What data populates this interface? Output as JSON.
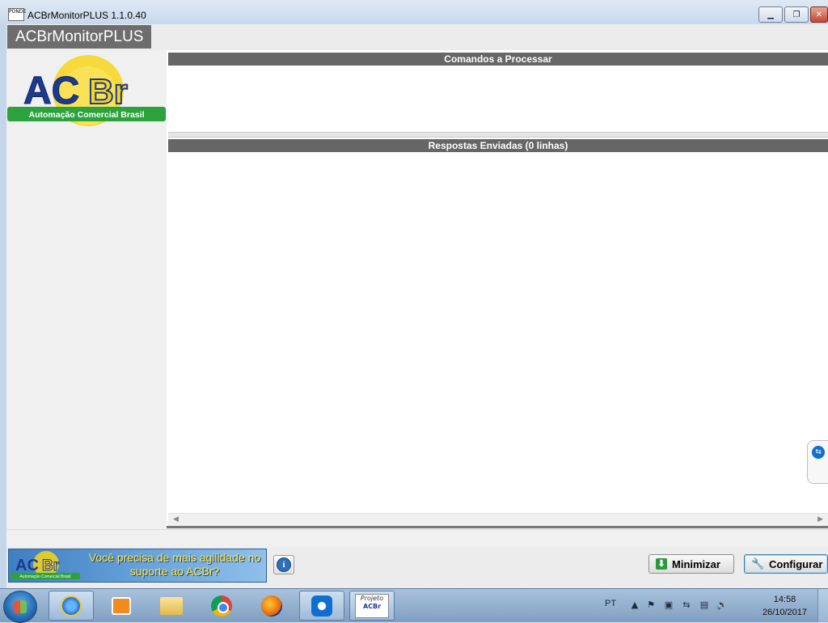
{
  "window": {
    "title": "ACBrMonitorPLUS 1.1.0.40",
    "icon_text": "PONDE",
    "controls": [
      "minimize-icon",
      "restore-icon",
      "close-icon"
    ]
  },
  "app": {
    "title": "ACBrMonitorPLUS"
  },
  "logo": {
    "main_text": "ACBr",
    "tagline": "Automação Comercial Brasil",
    "colors": {
      "blue": "#1d3a8f",
      "yellow": "#f7d51a",
      "green": "#2ba23b"
    }
  },
  "panels": {
    "top_header": "Comandos a Processar",
    "bottom_header": "Respostas Enviadas (0 linhas)"
  },
  "footer": {
    "banner_text": "Você precisa de mais agilidade no suporte ao ACBr?",
    "banner_logo_text": "ACBr",
    "banner_logo_tagline": "Automação Comercial Brasil",
    "info_label": "i",
    "minimize_label": "Minimizar",
    "configure_label": "Configurar"
  },
  "taskbar": {
    "items": [
      "start-icon",
      "ie-icon",
      "media-icon",
      "folder-icon",
      "chrome-icon",
      "firefox-icon",
      "teamviewer-icon",
      "projeto-acbr-icon"
    ],
    "projeto_label": "Projeto",
    "projeto_sub": "ACBr",
    "language": "PT",
    "time": "14:58",
    "date": "26/10/2017"
  }
}
